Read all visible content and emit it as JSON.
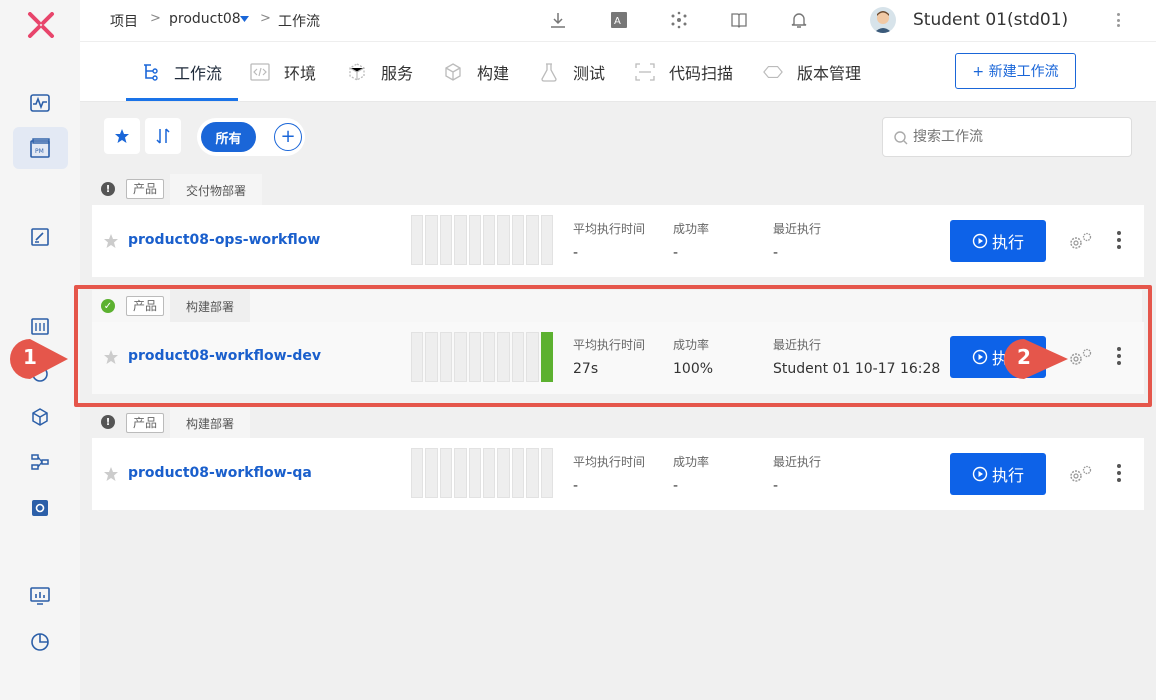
{
  "header": {
    "breadcrumb": [
      "项目",
      "product08",
      "工作流"
    ],
    "breadcrumb_separators": [
      ">",
      ">"
    ],
    "user_name": "Student 01(std01)"
  },
  "tabs": [
    {
      "label": "工作流",
      "icon": "workflow-icon",
      "active": true
    },
    {
      "label": "环境",
      "icon": "environment-icon"
    },
    {
      "label": "服务",
      "icon": "service-icon"
    },
    {
      "label": "构建",
      "icon": "build-icon"
    },
    {
      "label": "测试",
      "icon": "test-flask-icon"
    },
    {
      "label": "代码扫描",
      "icon": "code-scan-icon"
    },
    {
      "label": "版本管理",
      "icon": "version-icon"
    }
  ],
  "new_workflow_button": "+ 新建工作流",
  "filters": {
    "all_label": "所有",
    "add_symbol": "+"
  },
  "search": {
    "placeholder": "搜索工作流"
  },
  "stat_labels": {
    "avg_time": "平均执行时间",
    "success_rate": "成功率",
    "last_run": "最近执行"
  },
  "run_label": "执行",
  "workflows": [
    {
      "tag": "产品",
      "stage": "交付物部署",
      "status": "warning",
      "name": "product08-ops-workflow",
      "avg_time": "-",
      "success_rate": "-",
      "last_run": "-",
      "recent_runs": [
        null,
        null,
        null,
        null,
        null,
        null,
        null,
        null,
        null,
        null
      ]
    },
    {
      "tag": "产品",
      "stage": "构建部署",
      "status": "success",
      "name": "product08-workflow-dev",
      "avg_time": "27s",
      "success_rate": "100%",
      "last_run": "Student 01 10-17 16:28",
      "recent_runs": [
        null,
        null,
        null,
        null,
        null,
        null,
        null,
        null,
        null,
        "success"
      ]
    },
    {
      "tag": "产品",
      "stage": "构建部署",
      "status": "warning",
      "name": "product08-workflow-qa",
      "avg_time": "-",
      "success_rate": "-",
      "last_run": "-",
      "recent_runs": [
        null,
        null,
        null,
        null,
        null,
        null,
        null,
        null,
        null,
        null
      ]
    }
  ],
  "annotations": {
    "marker_1": "1",
    "marker_2": "2"
  },
  "colors": {
    "primary": "#0d62e8",
    "success": "#5cb130",
    "highlight": "#e5564b",
    "link": "#1a5fcc"
  }
}
